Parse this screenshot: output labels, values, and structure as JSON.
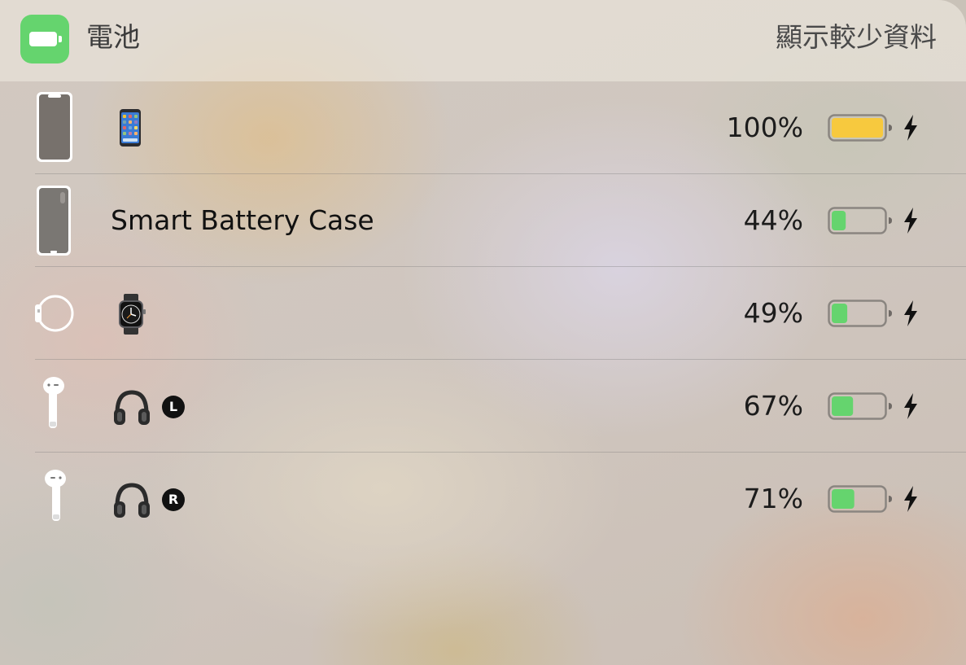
{
  "header": {
    "title": "電池",
    "show_less_label": "顯示較少資料",
    "app_icon": "battery-icon"
  },
  "devices": [
    {
      "icon": "iphone-icon",
      "label_icon": "iphone-emoji",
      "name": "",
      "percent_text": "100%",
      "level": 1.0,
      "fill_color": "#f7c93e",
      "charging": true
    },
    {
      "icon": "smart-battery-case-icon",
      "label_icon": "",
      "name": "Smart Battery Case",
      "percent_text": "44%",
      "level": 0.44,
      "fill_color": "#65d46e",
      "charging": true
    },
    {
      "icon": "apple-watch-icon",
      "label_icon": "watch-emoji",
      "name": "",
      "percent_text": "49%",
      "level": 0.49,
      "fill_color": "#65d46e",
      "charging": true
    },
    {
      "icon": "airpod-left-icon",
      "label_icon": "headphones-emoji",
      "name": "",
      "side_badge": "L",
      "percent_text": "67%",
      "level": 0.67,
      "fill_color": "#65d46e",
      "charging": true
    },
    {
      "icon": "airpod-right-icon",
      "label_icon": "headphones-emoji",
      "name": "",
      "side_badge": "R",
      "percent_text": "71%",
      "level": 0.71,
      "fill_color": "#65d46e",
      "charging": true
    }
  ],
  "colors": {
    "app_green": "#65d46e",
    "battery_yellow": "#f7c93e",
    "battery_green": "#65d46e"
  }
}
